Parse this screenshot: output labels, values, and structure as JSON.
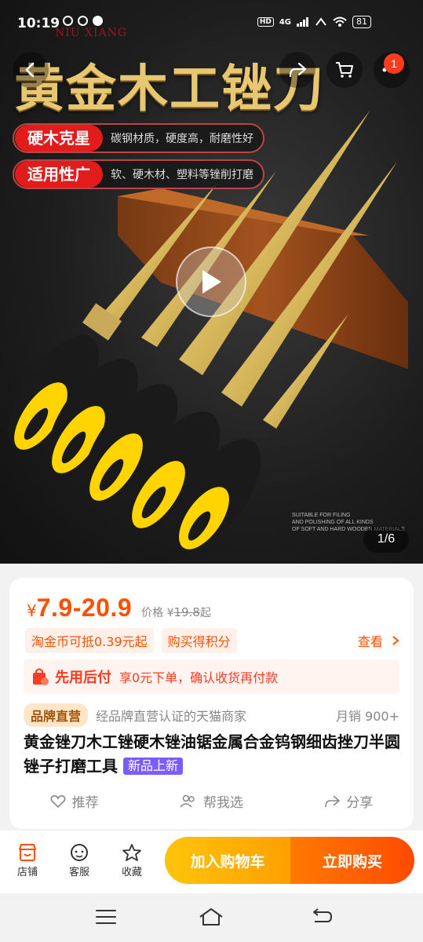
{
  "status_bar": {
    "time": "10:19",
    "network": "4G",
    "battery": "81",
    "watermark": "NIU XIANG"
  },
  "top_nav": {
    "cart_badge": "1"
  },
  "hero": {
    "headline": "黄金木工锉刀",
    "pills": [
      {
        "tag": "硬木克星",
        "desc": "碳钢材质，硬度高，耐磨性好"
      },
      {
        "tag": "适用性广",
        "desc": "软、硬木材、塑料等锉削打磨"
      }
    ],
    "fine_print": [
      "SUITABLE FOR FILING",
      "AND POLISHING OF ALL KINDS",
      "OF SOFT AND HARD WOODEN MATERIALS"
    ],
    "image_counter": "1/6"
  },
  "product": {
    "currency": "¥",
    "price_range": "7.9-20.9",
    "ref_label": "价格",
    "ref_currency": "¥",
    "ref_price": "19.8",
    "ref_suffix": "起",
    "chips": [
      "淘金币可抵0.39元起",
      "购买得积分"
    ],
    "look_label": "查看",
    "credit_title": "先用后付",
    "credit_desc": "享0元下单，确认收货再付款",
    "store_badge": "品牌直营",
    "store_desc": "经品牌直营认证的天猫商家",
    "monthly_sales": "月销 900+",
    "title": "黄金锉刀木工锉硬木锉油锯金属合金钨钢细齿挫刀半圆锉子打磨工具",
    "new_badge": "新品上新",
    "actions": [
      {
        "icon": "heart-icon",
        "label": "推荐"
      },
      {
        "icon": "people-icon",
        "label": "帮我选"
      },
      {
        "icon": "share-icon",
        "label": "分享"
      }
    ]
  },
  "bottom_bar": {
    "shop_label": "店铺",
    "service_label": "客服",
    "favorite_label": "收藏",
    "add_to_cart": "加入购物车",
    "buy_now": "立即购买"
  },
  "colors": {
    "accent": "#ff5000",
    "cart_button": "#ffb400",
    "buy_button": "#ff5a00",
    "new_badge": "#7a5cff"
  }
}
